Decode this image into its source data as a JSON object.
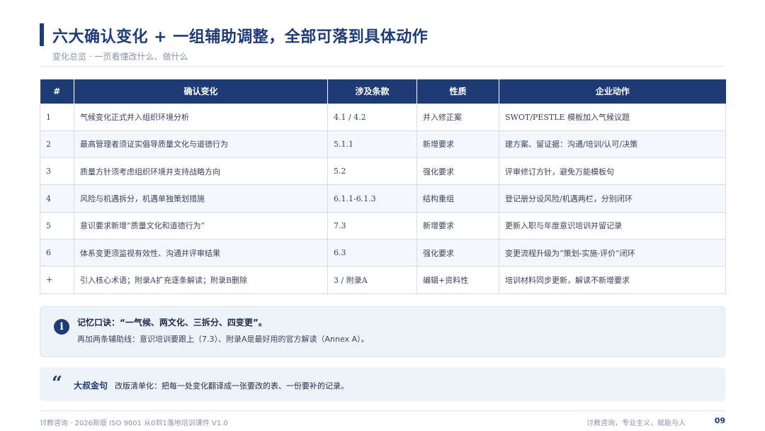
{
  "header": {
    "title": "六大确认变化 + 一组辅助调整，全部可落到具体动作",
    "subtitle": "变化总览 · 一页看懂改什么、做什么"
  },
  "table": {
    "columns": [
      "#",
      "确认变化",
      "涉及条款",
      "性质",
      "企业动作"
    ],
    "rows": [
      [
        "1",
        "气候变化正式并入组织环境分析",
        "4.1 / 4.2",
        "并入修正案",
        "SWOT/PESTLE 模板加入气候议题"
      ],
      [
        "2",
        "最高管理者须证实倡导质量文化与道德行为",
        "5.1.1",
        "新增要求",
        "建方案、留证据：沟通/培训/认可/决策"
      ],
      [
        "3",
        "质量方针须考虑组织环境并支持战略方向",
        "5.2",
        "强化要求",
        "评审修订方针，避免万能模板句"
      ],
      [
        "4",
        "风险与机遇拆分，机遇单独策划措施",
        "6.1.1-6.1.3",
        "结构重组",
        "登记册分设风险/机遇两栏，分别闭环"
      ],
      [
        "5",
        "意识要求新增“质量文化和道德行为”",
        "7.3",
        "新增要求",
        "更新入职与年度意识培训并留记录"
      ],
      [
        "6",
        "体系变更须监视有效性、沟通并评审结果",
        "6.3",
        "强化要求",
        "变更流程升级为“策划-实施-评价”闭环"
      ],
      [
        "+",
        "引入核心术语；附录A扩充逐条解读；附录B删除",
        "3 / 附录A",
        "编辑+资料性",
        "培训材料同步更新，解读不新增要求"
      ]
    ]
  },
  "note": {
    "icon": "info-icon",
    "line1": "记忆口诀：“一气候、两文化、三拆分、四变更”。",
    "line2": "再加两条辅助线：意识培训要跟上（7.3）、附录A是最好用的官方解读（Annex A）。"
  },
  "quote": {
    "icon": "quote-icon",
    "label": "大叔金句",
    "text": "改版清单化：把每一处变化翻译成一张要改的表、一份要补的记录。"
  },
  "footer": {
    "left": "讨教咨询 · 2026新版 ISO 9001 从0到1落地培训课件 V1.0",
    "right": "讨教咨询，专业主义，赋能与人",
    "page": "09"
  },
  "colors": {
    "accent": "#1f3b73",
    "panel": "#eef3fa"
  }
}
